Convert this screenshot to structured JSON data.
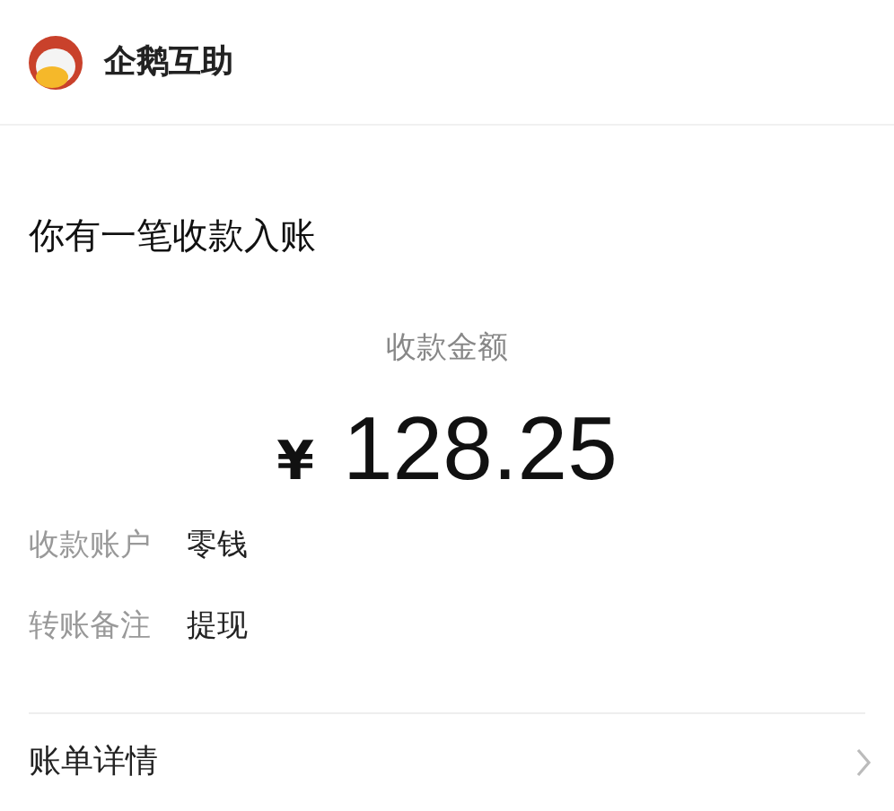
{
  "header": {
    "app_name": "企鹅互助"
  },
  "title": "你有一笔收款入账",
  "amount_label": "收款金额",
  "currency": "¥",
  "amount": "128.25",
  "details": [
    {
      "label": "收款账户",
      "value": "零钱"
    },
    {
      "label": "转账备注",
      "value": "提现"
    }
  ],
  "footer": {
    "label": "账单详情"
  }
}
